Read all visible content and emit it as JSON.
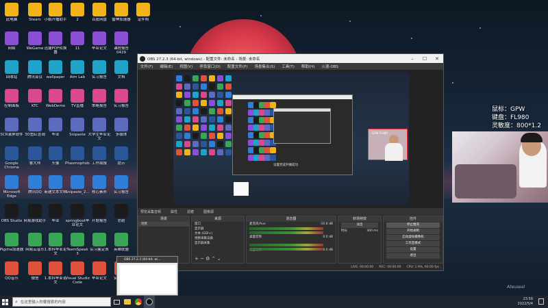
{
  "desktop": {
    "icons_col1": [
      "此电脑",
      "网络",
      "回收站",
      "控制面板",
      "SCR录屏软件",
      "Google Chrome",
      "Microsoft Edge",
      "OBS Studio",
      "Pigcha加速器",
      "QQ音乐"
    ],
    "icons_col2": [
      "Steam",
      "WeGame",
      "腾讯会议",
      "KTC",
      "3D鱼缸查询",
      "鲁大师",
      "腾讯QQ",
      "网易游戏助手",
      "网易云音乐",
      "微信"
    ],
    "icons_col3": [
      "小鹅开播助手",
      "迅捷PDF转换器",
      "wallpaper",
      "WebDemo",
      "毕业",
      "头像",
      "新建文本文档",
      "毕业",
      "1.本科毕业论文",
      "1.本科毕业论文"
    ],
    "icons_col4": [
      "2",
      "11",
      "Aim Lab",
      "TV直播",
      "Snipaste",
      "Phasmophobia",
      "Snipaste_2...",
      "springboot毕业论文",
      "TeamSpeak 3",
      "Visual Studio Code"
    ],
    "icons_col5": [
      "百度网盘",
      "毕业论文",
      "实习报告",
      "策略报告",
      "大学生毕业论文",
      "工作周报",
      "核心素养",
      "开题报告",
      "实习鉴定表",
      "毕业论文"
    ],
    "icons_col6": [
      "雷神加速器",
      "课程报告 0429",
      "文档",
      "实习报告",
      "多媒体",
      "提示",
      "实习报告",
      "总结",
      "英雄联盟",
      "实习报告"
    ],
    "icons_col7": [
      "证件照"
    ]
  },
  "obs": {
    "title": "OBS 27.2.3 (64-bit, windows) - 配置文件: 未命名 - 场景: 未命名",
    "menu": [
      "文件(F)",
      "编辑(E)",
      "视图(V)",
      "停靠窗口(D)",
      "配置文件(P)",
      "场景集合(S)",
      "工具(T)",
      "帮助(H)",
      "火速-OBS"
    ],
    "nested_message": "设置完成开播成功",
    "cam_label": "GPW FL980",
    "dock_bar": [
      "预览采集音频",
      "属性",
      "滤镜",
      "图像源"
    ],
    "docks": {
      "scenes_title": "场景",
      "scenes_item": "场景",
      "sources_title": "来源",
      "sources": [
        "窗口",
        "显示器",
        "文本 (GDI+)",
        "视频采集设备",
        "显示器采集"
      ],
      "mixer_title": "混音器",
      "mixer_channels": [
        {
          "name": "麦克风/Aux",
          "db": "-10.8 dB"
        },
        {
          "name": "桌面音频",
          "db": "0.0 dB"
        },
        {
          "name": "桌面音频",
          "db": "0.0 dB"
        }
      ],
      "transitions_title": "转场特效",
      "transitions": [
        "淡出",
        "时长"
      ],
      "transition_duration": "300 ms",
      "controls_title": "控件",
      "controls": [
        "停止推流",
        "开始录制",
        "启动虚拟摄像机",
        "工作室模式",
        "设置",
        "退出"
      ]
    },
    "status": [
      "LIVE: 00:00:00",
      "REC: 00:00:00",
      "CPU: 1.9%, 60.00 fps"
    ]
  },
  "overlay": {
    "lines": [
      "鼠标：GPW",
      "键盘：FL980",
      "灵敏度：800*1.2"
    ]
  },
  "thumbnail": {
    "title": "OBS 27.2.3 (64-bit, wi..."
  },
  "taskbar": {
    "search_placeholder": "在这里输入你要搜索的内容",
    "time": "23:59",
    "date": "2022/5/4"
  },
  "colors": {
    "taskbar": "#1e2530",
    "obs_bg": "#2b2b2b",
    "cam_border": "#e33333"
  }
}
